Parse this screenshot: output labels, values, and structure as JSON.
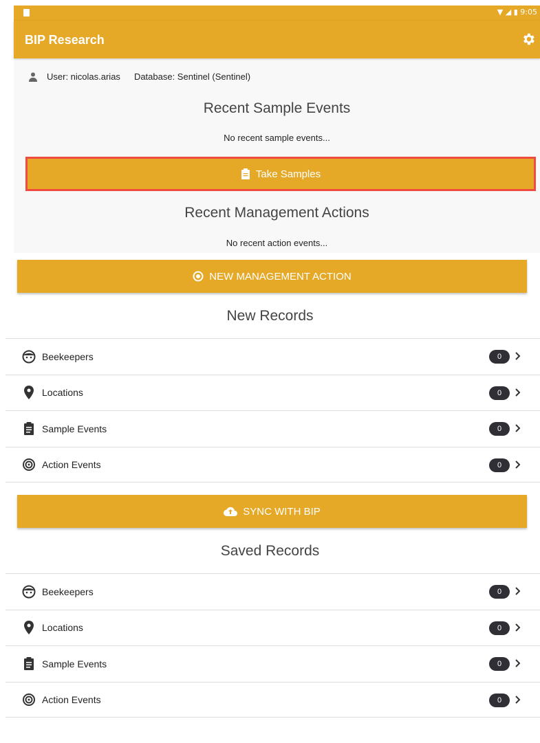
{
  "status_bar": {
    "time": "9:05"
  },
  "app": {
    "title": "BIP Research",
    "accent_color": "#e6a827"
  },
  "user_line": {
    "user": "User: nicolas.arias",
    "database": "Database: Sentinel (Sentinel)"
  },
  "recent_samples": {
    "heading": "Recent Sample Events",
    "empty_text": "No recent sample events...",
    "button_label": "Take Samples"
  },
  "recent_actions": {
    "heading": "Recent Management Actions",
    "empty_text": "No recent action events...",
    "button_label": "NEW MANAGEMENT ACTION"
  },
  "new_records": {
    "heading": "New Records",
    "items": [
      {
        "label": "Beekeepers",
        "count": "0",
        "icon": "face-icon"
      },
      {
        "label": "Locations",
        "count": "0",
        "icon": "map-pin-icon"
      },
      {
        "label": "Sample Events",
        "count": "0",
        "icon": "clipboard-icon"
      },
      {
        "label": "Action Events",
        "count": "0",
        "icon": "spiral-icon"
      }
    ]
  },
  "sync": {
    "button_label": "SYNC WITH BIP"
  },
  "saved_records": {
    "heading": "Saved Records",
    "items": [
      {
        "label": "Beekeepers",
        "count": "0",
        "icon": "face-icon"
      },
      {
        "label": "Locations",
        "count": "0",
        "icon": "map-pin-icon"
      },
      {
        "label": "Sample Events",
        "count": "0",
        "icon": "clipboard-icon"
      },
      {
        "label": "Action Events",
        "count": "0",
        "icon": "spiral-icon"
      }
    ]
  }
}
